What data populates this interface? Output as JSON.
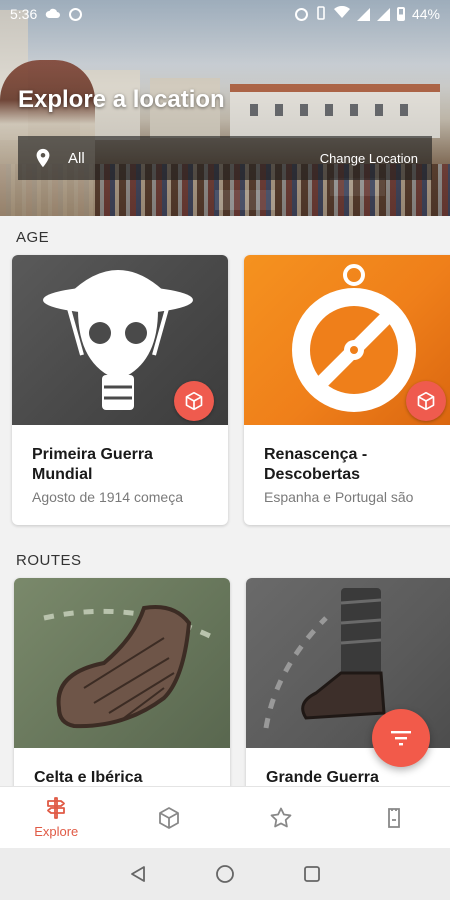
{
  "status_bar": {
    "time": "5:36",
    "battery": "44%",
    "left_icons": [
      "cloud-icon",
      "whatsapp-icon"
    ],
    "right_icons": [
      "alarm-icon",
      "vibrate-icon",
      "wifi-icon",
      "signal-icon",
      "signal-icon",
      "battery-icon"
    ]
  },
  "hero": {
    "title": "Explore a location",
    "location_value": "All",
    "change_location_label": "Change Location"
  },
  "sections": {
    "age": {
      "title": "AGE",
      "cards": [
        {
          "title": "Primeira Guerra Mundial",
          "subtitle": "Agosto de 1914 começa",
          "icon": "gas-mask-icon",
          "badge_icon": "cube-icon"
        },
        {
          "title": "Renascença - Descobertas",
          "subtitle": "Espanha e Portugal são",
          "icon": "astrolabe-icon",
          "badge_icon": "cube-icon"
        }
      ]
    },
    "routes": {
      "title": "ROUTES",
      "cards": [
        {
          "title": "Celta e Ibérica",
          "icon": "sandal-icon"
        },
        {
          "title": "Grande Guerra",
          "icon": "boot-icon"
        }
      ]
    }
  },
  "bottom_nav": {
    "items": [
      {
        "label": "Explore",
        "icon": "signpost-icon",
        "active": true
      },
      {
        "label": "",
        "icon": "cube-icon",
        "active": false
      },
      {
        "label": "",
        "icon": "star-icon",
        "active": false
      },
      {
        "label": "",
        "icon": "ticket-icon",
        "active": false
      }
    ]
  },
  "system_nav": [
    "back-icon",
    "home-icon",
    "recents-icon"
  ],
  "colors": {
    "accent": "#f25a4a",
    "active_nav": "#e05a45",
    "card_ww1_bg": "#4a4a4a",
    "card_renaissance_bg": "#f07c1c",
    "card_celta_bg": "#6b7a5e",
    "card_grande_guerra_bg": "#5e5e5e"
  }
}
